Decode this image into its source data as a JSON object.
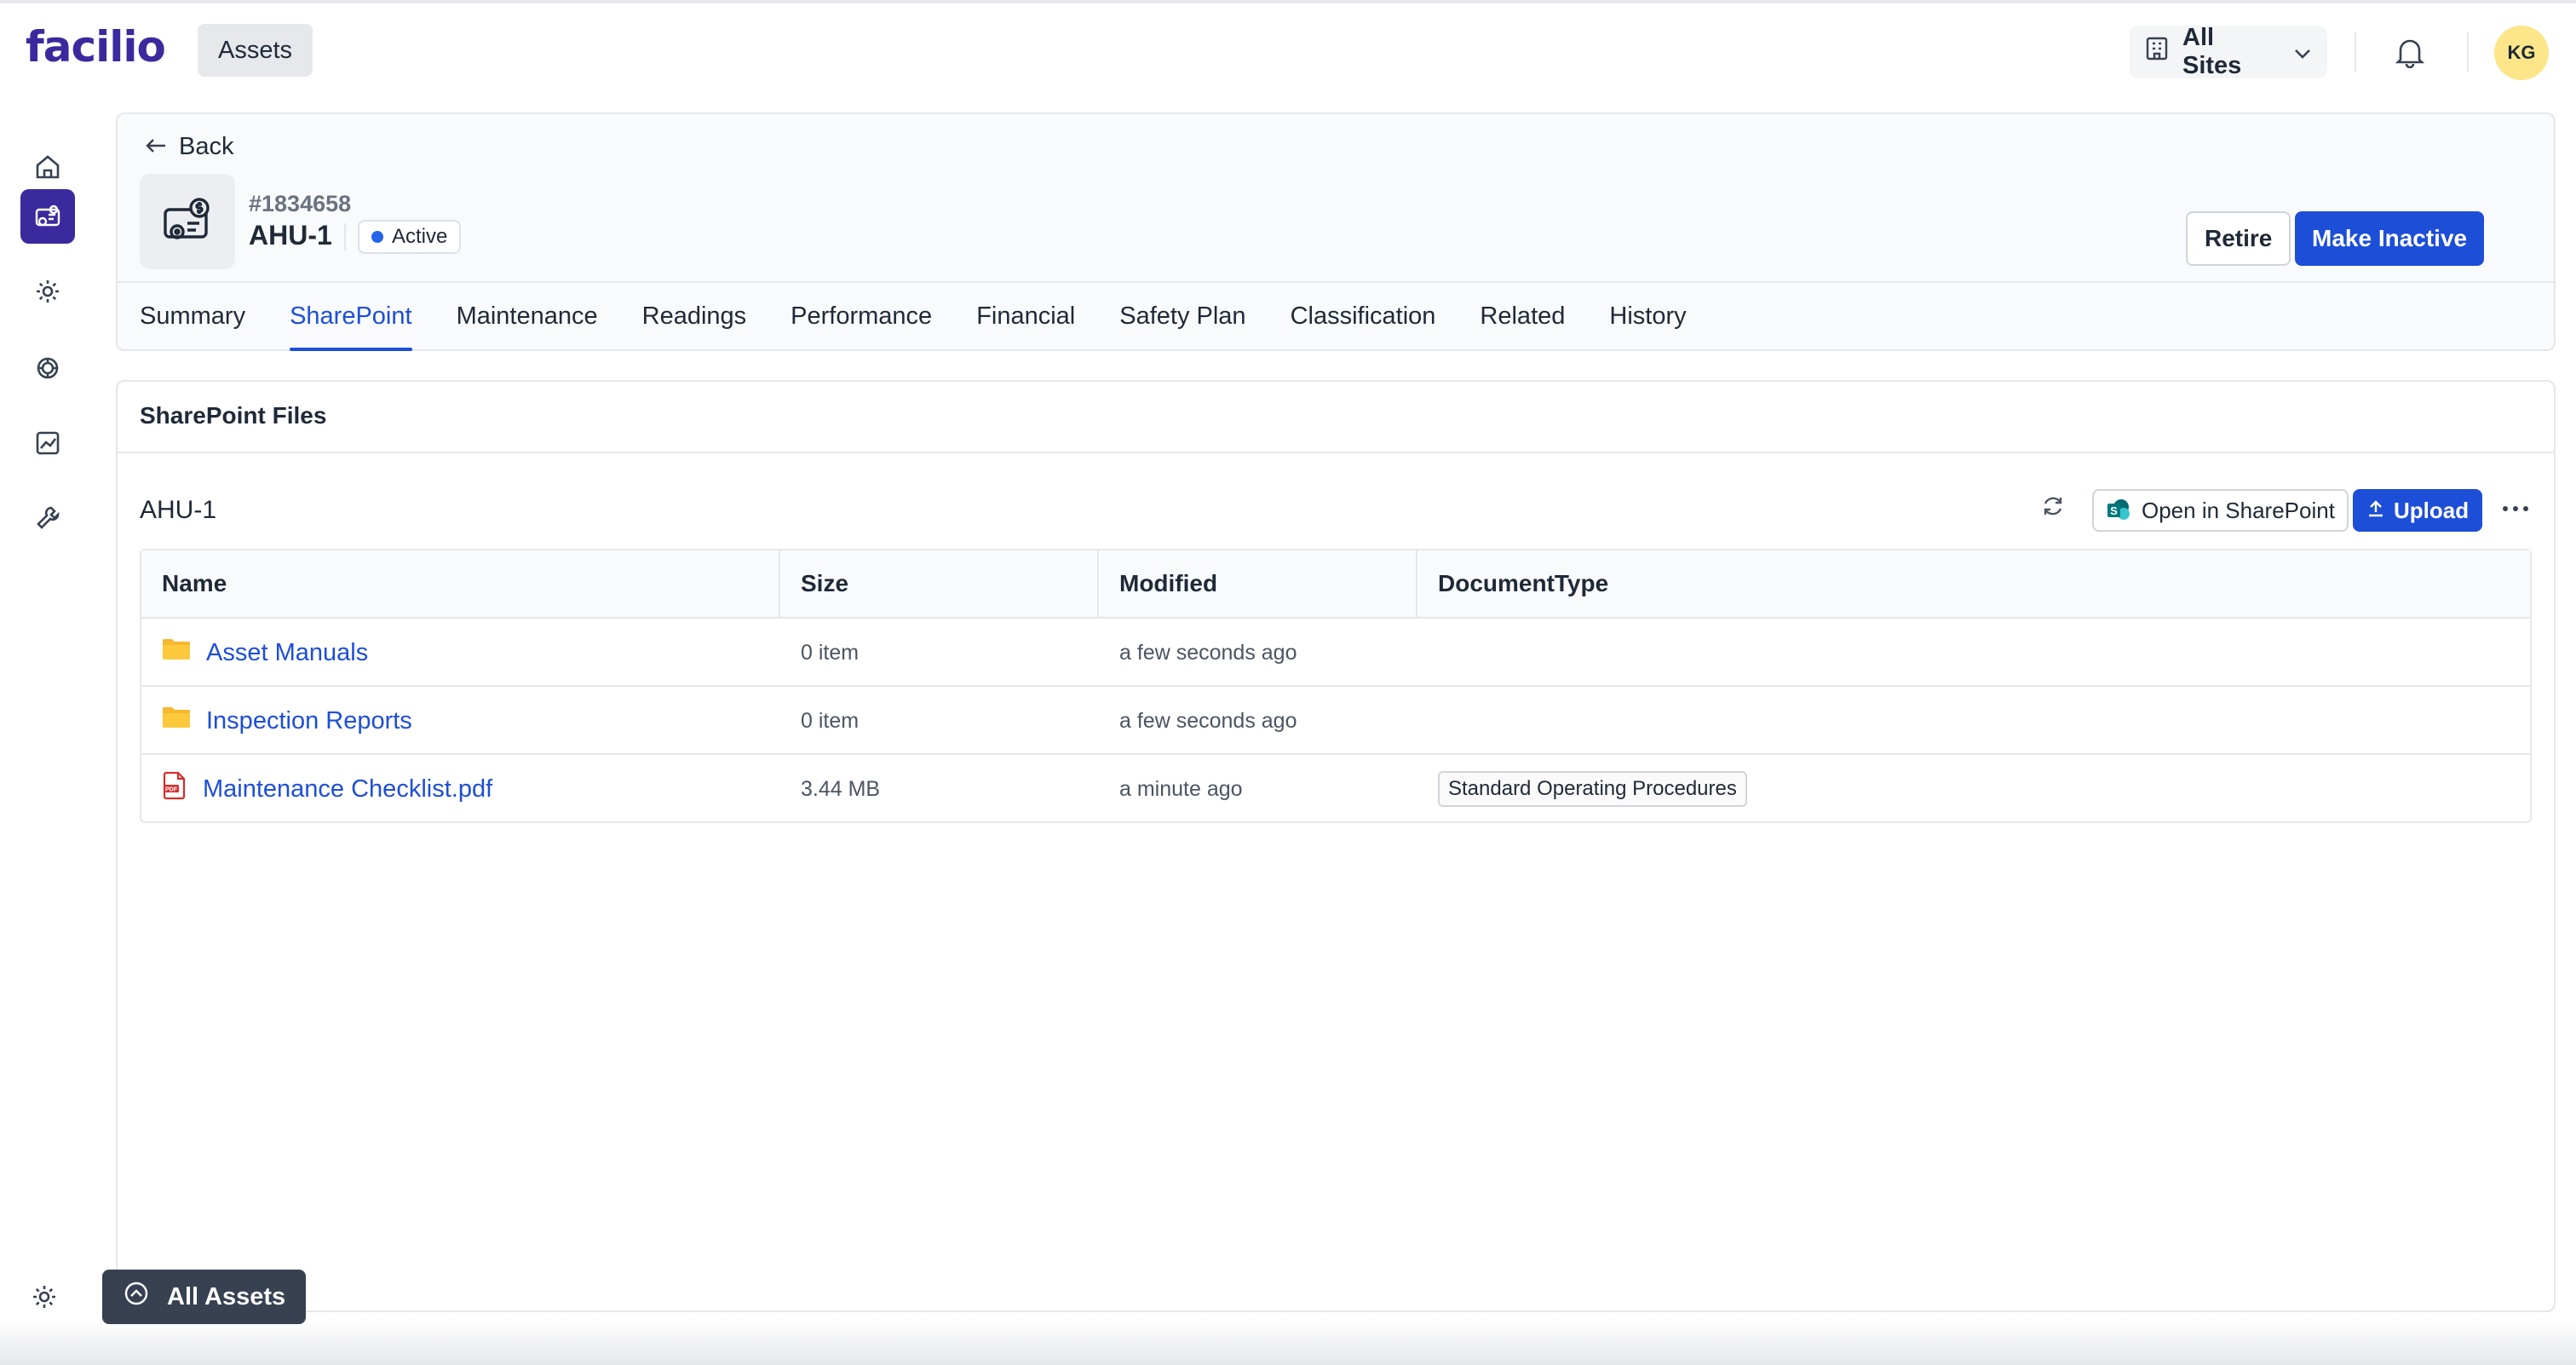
{
  "header": {
    "logo_text": "facilio",
    "module_label": "Assets",
    "site_selector_label": "All Sites",
    "user_initials": "KG"
  },
  "rail": {
    "items": [
      "home-icon",
      "assets-icon",
      "settings-gear-icon",
      "components-icon",
      "analytics-icon",
      "tools-icon"
    ],
    "active_index": 1,
    "bottom_icon": "settings-icon"
  },
  "asset": {
    "back_label": "Back",
    "id": "#1834658",
    "name": "AHU-1",
    "status": "Active",
    "retire_label": "Retire",
    "make_inactive_label": "Make Inactive"
  },
  "tabs": [
    {
      "label": "Summary",
      "active": false
    },
    {
      "label": "SharePoint",
      "active": true
    },
    {
      "label": "Maintenance",
      "active": false
    },
    {
      "label": "Readings",
      "active": false
    },
    {
      "label": "Performance",
      "active": false
    },
    {
      "label": "Financial",
      "active": false
    },
    {
      "label": "Safety Plan",
      "active": false
    },
    {
      "label": "Classification",
      "active": false
    },
    {
      "label": "Related",
      "active": false
    },
    {
      "label": "History",
      "active": false
    }
  ],
  "files": {
    "section_title": "SharePoint Files",
    "folder_name": "AHU-1",
    "open_sharepoint_label": "Open in SharePoint",
    "upload_label": "Upload",
    "columns": [
      "Name",
      "Size",
      "Modified",
      "DocumentType"
    ],
    "rows": [
      {
        "type": "folder",
        "name": "Asset Manuals",
        "size": "0 item",
        "modified": "a few seconds ago",
        "document_type": ""
      },
      {
        "type": "folder",
        "name": "Inspection Reports",
        "size": "0 item",
        "modified": "a few seconds ago",
        "document_type": ""
      },
      {
        "type": "pdf",
        "name": "Maintenance Checklist.pdf",
        "size": "3.44 MB",
        "modified": "a minute ago",
        "document_type": "Standard Operating Procedures"
      }
    ]
  },
  "footer": {
    "all_assets_label": "All Assets"
  },
  "colors": {
    "brand": "#3b2a9e",
    "primary": "#1d4ed8",
    "status_active": "#2563eb",
    "avatar_bg": "#fde68a",
    "folder": "#f5b82e"
  }
}
